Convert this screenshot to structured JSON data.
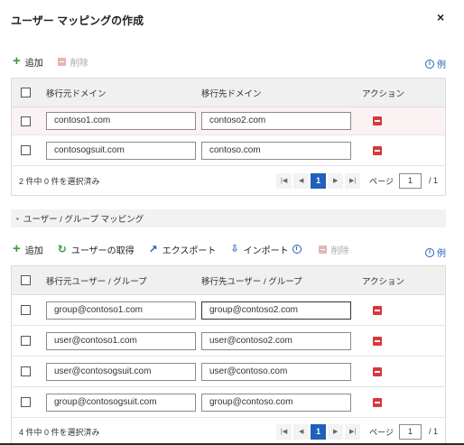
{
  "dialog": {
    "title": "ユーザー マッピングの作成",
    "close": "×"
  },
  "domain_toolbar": {
    "add": "追加",
    "delete": "削除",
    "example": "例"
  },
  "domain_grid": {
    "columns": [
      "移行元ドメイン",
      "移行先ドメイン",
      "アクション"
    ],
    "rows": [
      {
        "source": "contoso1.com",
        "target": "contoso2.com"
      },
      {
        "source": "contosogsuit.com",
        "target": "contoso.com"
      }
    ],
    "status": "2 件中 0 件を選択済み",
    "current_page": "1",
    "page_label": "ページ",
    "page_input": "1",
    "page_total": "/ 1"
  },
  "section": {
    "title": "ユーザー / グループ マッピング"
  },
  "user_toolbar": {
    "add": "追加",
    "fetch": "ユーザーの取得",
    "export": "エクスポート",
    "import": "インポート",
    "delete": "削除",
    "example": "例"
  },
  "user_grid": {
    "columns": [
      "移行元ユーザー / グループ",
      "移行先ユーザー / グループ",
      "アクション"
    ],
    "rows": [
      {
        "source": "group@contoso1.com",
        "target": "group@contoso2.com"
      },
      {
        "source": "user@contoso1.com",
        "target": "user@contoso2.com"
      },
      {
        "source": "user@contosogsuit.com",
        "target": "user@contoso.com"
      },
      {
        "source": "group@contosogsuit.com",
        "target": "group@contoso.com"
      }
    ],
    "status": "4 件中 0 件を選択済み",
    "current_page": "1",
    "page_label": "ページ",
    "page_input": "1",
    "page_total": "/ 1"
  },
  "pager_icons": [
    "first-page-icon",
    "prev-page-icon",
    "next-page-icon",
    "last-page-icon"
  ],
  "colors": {
    "accent": "#2160b8",
    "add_green": "#3a9b3a",
    "delete_red": "#d9363e",
    "header_bg": "#f0f0f0",
    "highlight_row": "#fbf2f4"
  }
}
